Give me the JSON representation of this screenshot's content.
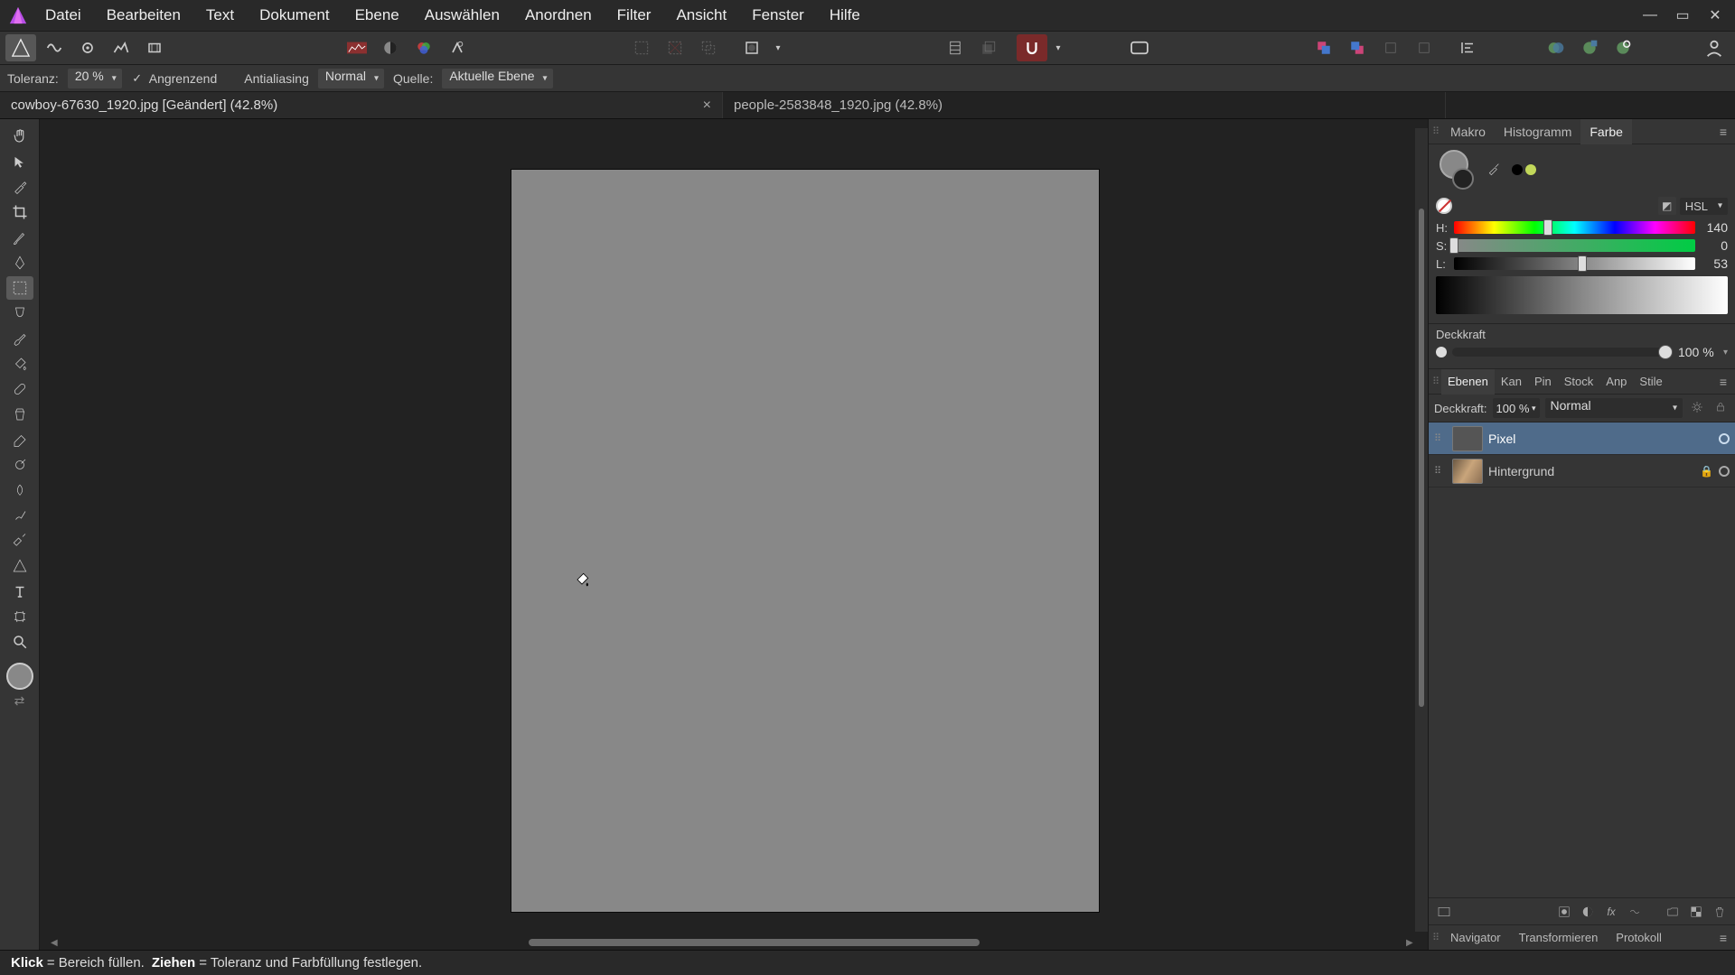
{
  "menubar": [
    "Datei",
    "Bearbeiten",
    "Text",
    "Dokument",
    "Ebene",
    "Auswählen",
    "Anordnen",
    "Filter",
    "Ansicht",
    "Fenster",
    "Hilfe"
  ],
  "contextbar": {
    "tolerance_label": "Toleranz:",
    "tolerance_value": "20 %",
    "contiguous": "Angrenzend",
    "antialias": "Antialiasing",
    "blend_mode": "Normal",
    "source_label": "Quelle:",
    "source_value": "Aktuelle Ebene"
  },
  "tabs": [
    {
      "title": "cowboy-67630_1920.jpg [Geändert] (42.8%)",
      "active": true
    },
    {
      "title": "people-2583848_1920.jpg (42.8%)",
      "active": false
    }
  ],
  "right": {
    "top_tabs": [
      "Makro",
      "Histogramm",
      "Farbe"
    ],
    "color_model": "HSL",
    "h_label": "H:",
    "h_value": "140",
    "s_label": "S:",
    "s_value": "0",
    "l_label": "L:",
    "l_value": "53",
    "opacity_label": "Deckkraft",
    "opacity_value": "100 %"
  },
  "layers": {
    "tabs": [
      "Ebenen",
      "Kan",
      "Pin",
      "Stock",
      "Anp",
      "Stile"
    ],
    "opacity_label": "Deckkraft:",
    "opacity_value": "100 %",
    "blend_mode": "Normal",
    "items": [
      {
        "name": "Pixel",
        "selected": true,
        "bg": false
      },
      {
        "name": "Hintergrund",
        "selected": false,
        "bg": true
      }
    ]
  },
  "bottom_tabs": [
    "Navigator",
    "Transformieren",
    "Protokoll"
  ],
  "status": {
    "k1": "Klick",
    "t1": "= Bereich füllen.",
    "k2": "Ziehen",
    "t2": "= Toleranz und Farbfüllung festlegen."
  },
  "recent_colors": [
    "#000000",
    "#c2d85a"
  ]
}
